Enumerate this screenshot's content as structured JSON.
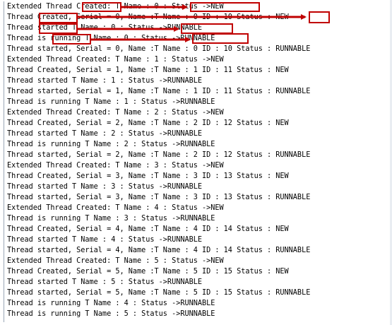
{
  "console": {
    "lines": [
      "Extended Thread Created: T Name : 0 : Status ->NEW",
      "Thread Created, Serial = 0, Name :T Name : 0 ID : 10 Status : NEW",
      "Thread started T Name : 0 : Status ->RUNNABLE",
      "Thread is running T Name : 0 : Status ->RUNNABLE",
      "Thread started, Serial = 0, Name :T Name : 0 ID : 10 Status : RUNNABLE",
      "Extended Thread Created: T Name : 1 : Status ->NEW",
      "Thread Created, Serial = 1, Name :T Name : 1 ID : 11 Status : NEW",
      "Thread started T Name : 1 : Status ->RUNNABLE",
      "Thread started, Serial = 1, Name :T Name : 1 ID : 11 Status : RUNNABLE",
      "Thread is running T Name : 1 : Status ->RUNNABLE",
      "Extended Thread Created: T Name : 2 : Status ->NEW",
      "Thread Created, Serial = 2, Name :T Name : 2 ID : 12 Status : NEW",
      "Thread started T Name : 2 : Status ->RUNNABLE",
      "Thread is running T Name : 2 : Status ->RUNNABLE",
      "Thread started, Serial = 2, Name :T Name : 2 ID : 12 Status : RUNNABLE",
      "Extended Thread Created: T Name : 3 : Status ->NEW",
      "Thread Created, Serial = 3, Name :T Name : 3 ID : 13 Status : NEW",
      "Thread started T Name : 3 : Status ->RUNNABLE",
      "Thread started, Serial = 3, Name :T Name : 3 ID : 13 Status : RUNNABLE",
      "Extended Thread Created: T Name : 4 : Status ->NEW",
      "Thread is running T Name : 3 : Status ->RUNNABLE",
      "Thread Created, Serial = 4, Name :T Name : 4 ID : 14 Status : NEW",
      "Thread started T Name : 4 : Status ->RUNNABLE",
      "Thread started, Serial = 4, Name :T Name : 4 ID : 14 Status : RUNNABLE",
      "Extended Thread Created: T Name : 5 : Status ->NEW",
      "Thread Created, Serial = 5, Name :T Name : 5 ID : 15 Status : NEW",
      "Thread started T Name : 5 : Status ->RUNNABLE",
      "Thread started, Serial = 5, Name :T Name : 5 ID : 15 Status : RUNNABLE",
      "Thread is running T Name : 4 : Status ->RUNNABLE",
      "Thread is running T Name : 5 : Status ->RUNNABLE"
    ]
  },
  "annotations": {
    "color": "#c00000",
    "highlighted_words": [
      "Created",
      "Created",
      "started",
      "running"
    ],
    "highlighted_statuses": [
      "Status ->NEW",
      "NEW",
      "->RUNNABLE",
      "->RUNNABLE"
    ]
  }
}
